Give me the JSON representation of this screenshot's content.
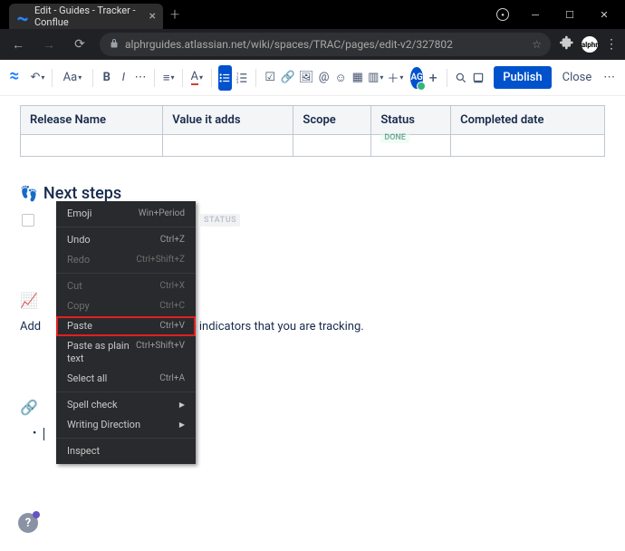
{
  "browser": {
    "tab_title": "Edit - Guides - Tracker - Conflue",
    "url": "alphrguides.atlassian.net/wiki/spaces/TRAC/pages/edit-v2/327802",
    "avatar_text": "alphr"
  },
  "toolbar": {
    "avatar_initials": "AG",
    "heading_style": "Aa",
    "publish_label": "Publish",
    "close_label": "Close"
  },
  "table": {
    "headers": [
      "Release Name",
      "Value it adds",
      "Scope",
      "Status",
      "Completed date"
    ],
    "status_value": "DONE"
  },
  "sections": {
    "next_steps": {
      "title": "Next steps",
      "icon": "👣",
      "mention": "STATUS"
    },
    "perf": {
      "icon": "📈",
      "desc_prefix": "Add",
      "desc_rest": "ance indicators that you are tracking."
    },
    "refs": {
      "icon": "🔗"
    }
  },
  "context_menu": {
    "items": [
      {
        "label": "Emoji",
        "shortcut": "Win+Period",
        "disabled": false
      },
      "sep",
      {
        "label": "Undo",
        "shortcut": "Ctrl+Z",
        "disabled": false
      },
      {
        "label": "Redo",
        "shortcut": "Ctrl+Shift+Z",
        "disabled": true
      },
      "sep",
      {
        "label": "Cut",
        "shortcut": "Ctrl+X",
        "disabled": true
      },
      {
        "label": "Copy",
        "shortcut": "Ctrl+C",
        "disabled": true
      },
      {
        "label": "Paste",
        "shortcut": "Ctrl+V",
        "disabled": false,
        "highlight": true
      },
      {
        "label": "Paste as plain text",
        "shortcut": "Ctrl+Shift+V",
        "disabled": false
      },
      {
        "label": "Select all",
        "shortcut": "Ctrl+A",
        "disabled": false
      },
      "sep",
      {
        "label": "Spell check",
        "submenu": true
      },
      {
        "label": "Writing Direction",
        "submenu": true
      },
      "sep",
      {
        "label": "Inspect"
      }
    ]
  },
  "help_label": "?"
}
